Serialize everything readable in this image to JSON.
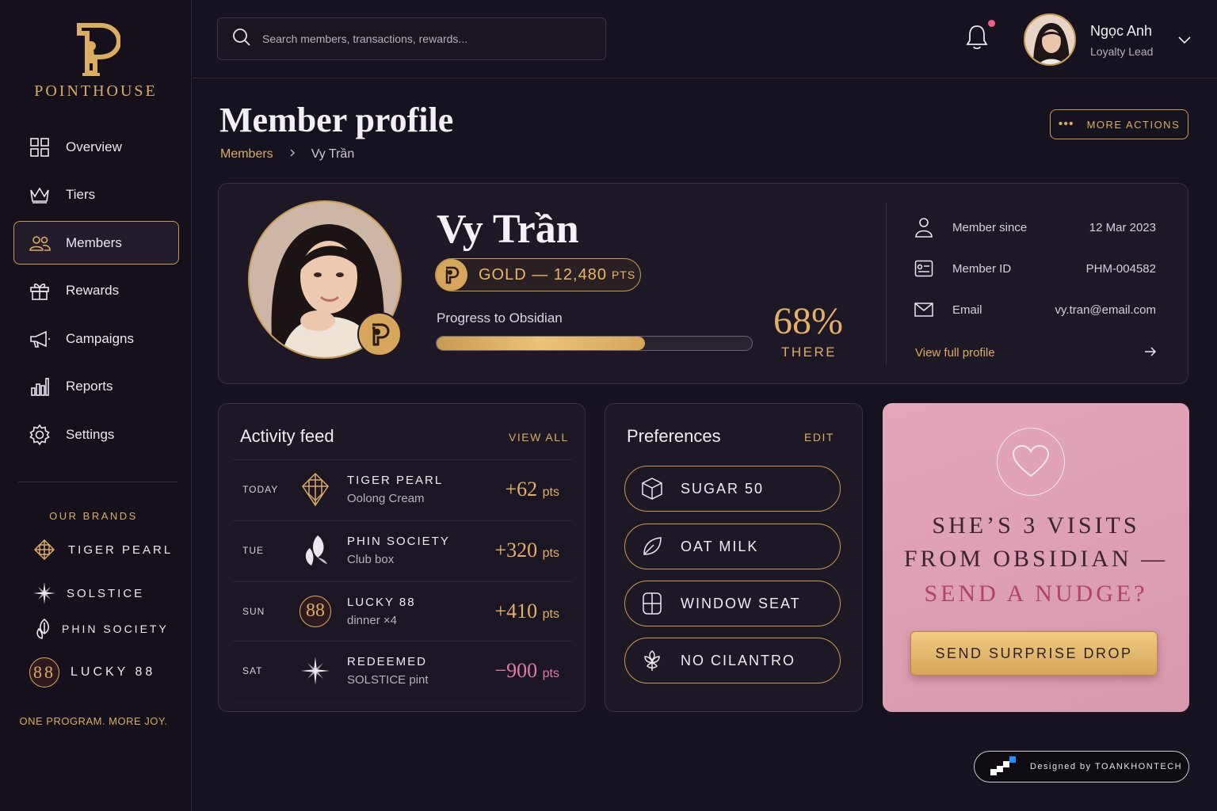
{
  "brand": {
    "name": "POINTHOUSE",
    "tagline": "ONE PROGRAM. MORE JOY."
  },
  "nav": [
    {
      "label": "Overview",
      "icon": "grid-icon"
    },
    {
      "label": "Tiers",
      "icon": "crown-icon"
    },
    {
      "label": "Members",
      "icon": "users-icon",
      "active": true
    },
    {
      "label": "Rewards",
      "icon": "gift-icon"
    },
    {
      "label": "Campaigns",
      "icon": "megaphone-icon"
    },
    {
      "label": "Reports",
      "icon": "bar-chart-icon"
    },
    {
      "label": "Settings",
      "icon": "gear-icon"
    }
  ],
  "brands": {
    "title": "OUR BRANDS",
    "items": [
      "TIGER PEARL",
      "SOLSTICE",
      "PHIN SOCIETY",
      "LUCKY 88"
    ],
    "lucky_badge": "88"
  },
  "header": {
    "search_placeholder": "Search members, transactions, rewards...",
    "user_name": "Ngọc Anh",
    "user_role": "Loyalty Lead"
  },
  "page": {
    "title": "Member profile",
    "breadcrumb": [
      "Members",
      "Vy Trần"
    ],
    "more_actions": "MORE ACTIONS"
  },
  "profile": {
    "name": "Vy Trần",
    "tier": "GOLD — 12,480",
    "tier_pts": "PTS",
    "progress_label": "Progress to Obsidian",
    "progress_fraction": 0.66,
    "progress_pct": "68%",
    "progress_note": "THERE",
    "info": [
      {
        "label": "Member since",
        "value": "12 Mar 2023",
        "icon": "user-icon"
      },
      {
        "label": "Member ID",
        "value": "PHM-004582",
        "icon": "id-card-icon"
      },
      {
        "label": "Email",
        "value": "vy.tran@email.com",
        "icon": "mail-icon"
      }
    ],
    "view_full": "View full profile"
  },
  "activity": {
    "title": "Activity feed",
    "view_all": "VIEW ALL",
    "rows": [
      {
        "day": "TODAY",
        "title": "TIGER PEARL",
        "sub": "Oolong Cream",
        "pts": "+62",
        "unit": "pts"
      },
      {
        "day": "TUE",
        "title": "PHIN SOCIETY",
        "sub": "Club box",
        "pts": "+320",
        "unit": "pts"
      },
      {
        "day": "SUN",
        "title": "LUCKY 88",
        "sub": "dinner ×4",
        "pts": "+410",
        "unit": "pts",
        "badge": "88"
      },
      {
        "day": "SAT",
        "title": "REDEEMED",
        "sub": "SOLSTICE pint",
        "pts": "−900",
        "unit": "pts"
      }
    ]
  },
  "preferences": {
    "title": "Preferences",
    "edit": "EDIT",
    "items": [
      "SUGAR 50",
      "OAT MILK",
      "WINDOW SEAT",
      "NO CILANTRO"
    ]
  },
  "nudge": {
    "line1": "SHE’S 3 VISITS",
    "line2": "FROM OBSIDIAN —",
    "line3": "SEND A NUDGE?",
    "button": "SEND SURPRISE DROP"
  },
  "credit": {
    "label": "Designed by TOANKHONTECH"
  },
  "colors": {
    "gold": "#d9ad62",
    "background": "#17121f",
    "pink_card": "#e0a2b6",
    "negative": "#e07aa8"
  }
}
